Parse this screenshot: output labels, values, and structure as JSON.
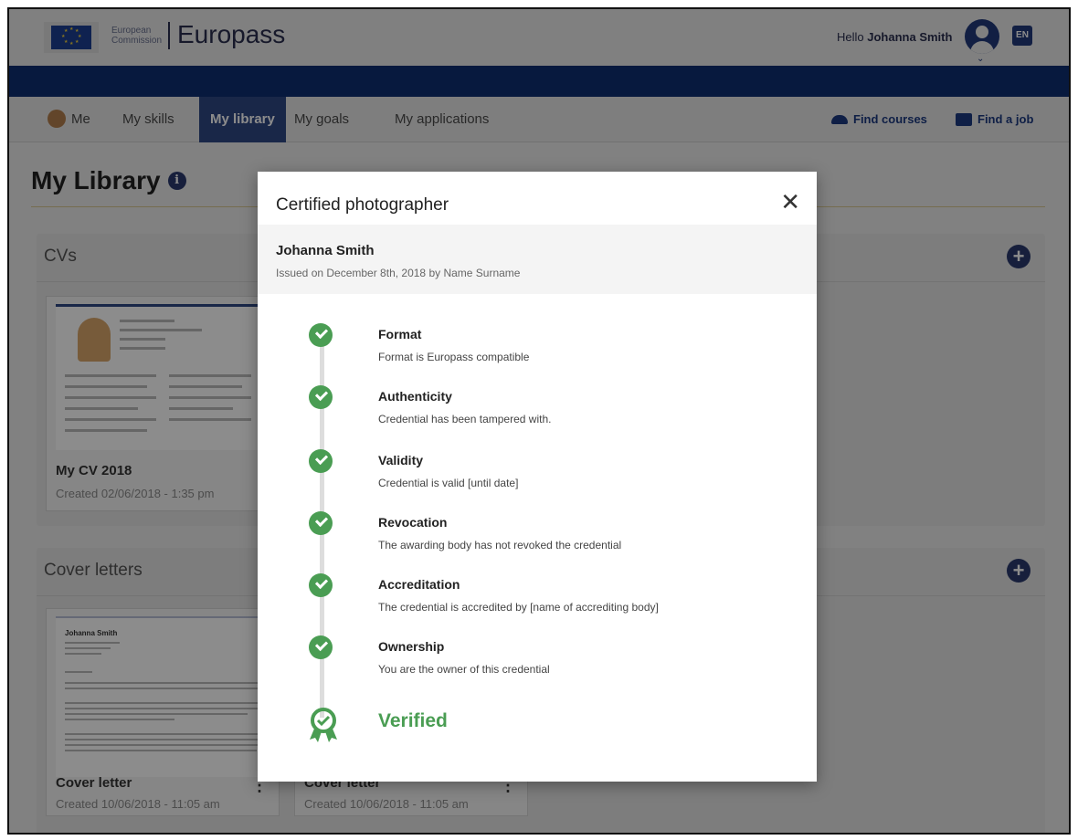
{
  "header": {
    "ec_line1": "European",
    "ec_line2": "Commission",
    "brand": "Europass",
    "greeting": "Hello",
    "user_name": "Johanna Smith",
    "language": "EN"
  },
  "nav": {
    "items": [
      {
        "label": "Me"
      },
      {
        "label": "My skills"
      },
      {
        "label": "My library",
        "active": true
      },
      {
        "label": "My goals"
      },
      {
        "label": "My applications"
      }
    ],
    "find_courses": "Find courses",
    "find_job": "Find a job"
  },
  "page": {
    "title": "My Library",
    "info_icon": "info-icon",
    "sections": [
      {
        "title": "CVs",
        "cards": [
          {
            "title": "My CV 2018",
            "date": "Created 02/06/2018 - 1:35 pm"
          }
        ]
      },
      {
        "title": "Cover letters",
        "cards": [
          {
            "title": "Cover letter",
            "date": "Created 10/06/2018 - 11:05 am",
            "thumb_name": "Johanna Smith"
          },
          {
            "title": "Cover letter",
            "date": "Created 10/06/2018 - 11:05 am"
          }
        ]
      }
    ]
  },
  "modal": {
    "title": "Certified photographer",
    "close_icon": "close-icon",
    "holder": "Johanna Smith",
    "issued": "Issued on December 8th, 2018 by Name Surname",
    "checks": [
      {
        "title": "Format",
        "desc": "Format is Europass compatible"
      },
      {
        "title": "Authenticity",
        "desc": "Credential has been tampered with."
      },
      {
        "title": "Validity",
        "desc": "Credential is valid [until date]"
      },
      {
        "title": "Revocation",
        "desc": "The awarding body has not revoked the credential"
      },
      {
        "title": "Accreditation",
        "desc": "The credential is accredited by [name of accrediting body]"
      },
      {
        "title": "Ownership",
        "desc": "You are the owner of this credential"
      }
    ],
    "status": "Verified"
  },
  "colors": {
    "brand_navy": "#0e2e72",
    "nav_active": "#2f4783",
    "success_green": "#4a9d53"
  }
}
